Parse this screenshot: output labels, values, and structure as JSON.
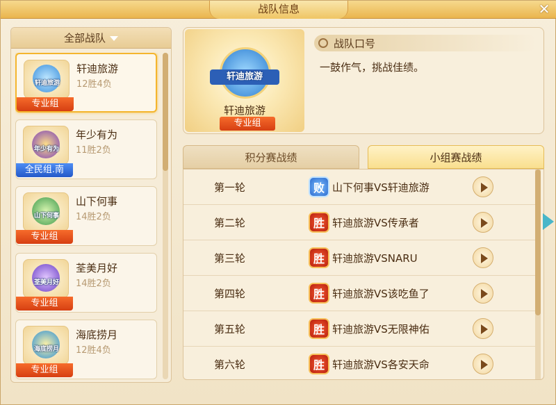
{
  "window": {
    "title": "战队信息",
    "close_symbol": "✕"
  },
  "filter": {
    "label": "全部战队"
  },
  "teams": [
    {
      "name": "轩迪旅游",
      "record": "12胜4负",
      "group": "专业组",
      "logo_text": "轩迪旅游",
      "selected": true
    },
    {
      "name": "年少有为",
      "record": "11胜2负",
      "group": "全民组.南",
      "logo_text": "年少有为",
      "selected": false
    },
    {
      "name": "山下何事",
      "record": "14胜2负",
      "group": "专业组",
      "logo_text": "山下何事",
      "selected": false
    },
    {
      "name": "荃美月好",
      "record": "14胜2负",
      "group": "专业组",
      "logo_text": "荃美月好",
      "selected": false
    },
    {
      "name": "海底捞月",
      "record": "12胜4负",
      "group": "专业组",
      "logo_text": "海底捞月",
      "selected": false
    }
  ],
  "info": {
    "logo_text": "轩迪旅游",
    "name": "轩迪旅游",
    "group": "专业组",
    "slogan_label": "战队口号",
    "slogan": "一鼓作气，挑战佳绩。"
  },
  "tabs": {
    "points": "积分赛战绩",
    "group_stage": "小组赛战绩"
  },
  "matches": [
    {
      "round": "第一轮",
      "result": "败",
      "matchup": "山下何事VS轩迪旅游"
    },
    {
      "round": "第二轮",
      "result": "胜",
      "matchup": "轩迪旅游VS传承者"
    },
    {
      "round": "第三轮",
      "result": "胜",
      "matchup": "轩迪旅游VSNARU"
    },
    {
      "round": "第四轮",
      "result": "胜",
      "matchup": "轩迪旅游VS该吃鱼了"
    },
    {
      "round": "第五轮",
      "result": "胜",
      "matchup": "轩迪旅游VS无限神佑"
    },
    {
      "round": "第六轮",
      "result": "胜",
      "matchup": "轩迪旅游VS各安天命"
    }
  ],
  "colors": {
    "accent": "#f4b52d",
    "pro_tag": "#e2521d",
    "public_tag": "#3570dd",
    "win": "#d63a1c",
    "lose": "#3b7ad8"
  }
}
